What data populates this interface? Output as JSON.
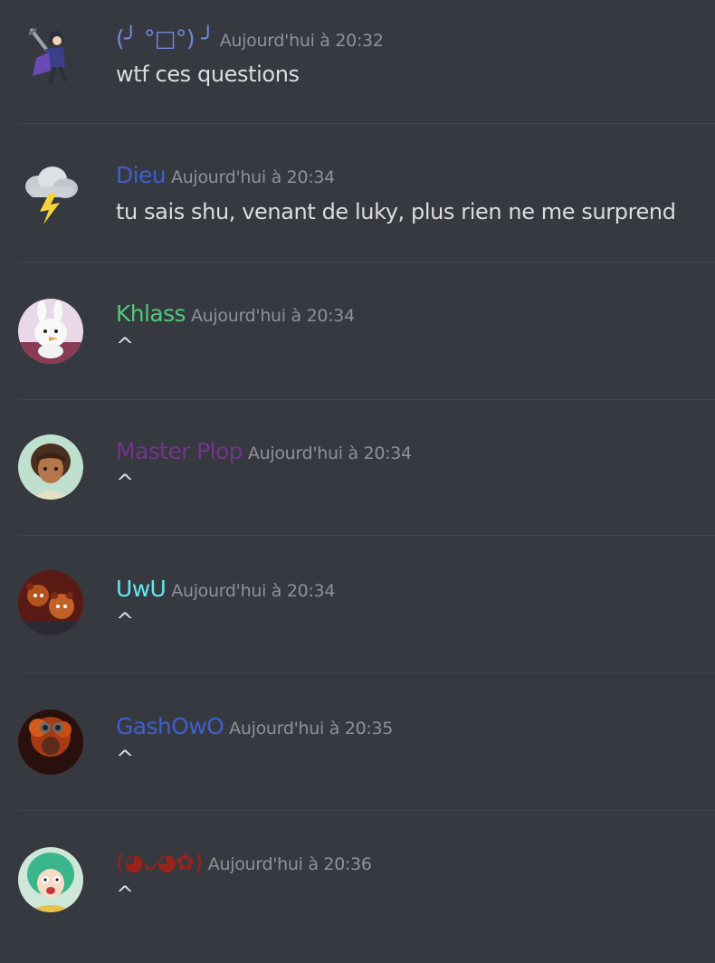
{
  "messages": [
    {
      "username": "(╯ °□°) ╯",
      "user_color": "#7289da",
      "timestamp": "Aujourd'hui à 20:32",
      "content": "wtf ces questions",
      "avatar_icon": "swordsman-avatar-icon"
    },
    {
      "username": "Dieu",
      "user_color": "#3e5fcf",
      "timestamp": "Aujourd'hui à 20:34",
      "content": "tu sais shu, venant de luky, plus rien ne me surprend",
      "avatar_icon": "storm-cloud-lightning-icon"
    },
    {
      "username": "Khlass",
      "user_color": "#4fc97a",
      "timestamp": "Aujourd'hui à 20:34",
      "content": "^",
      "avatar_icon": "rabbit-creature-avatar-icon"
    },
    {
      "username": "Master Plop",
      "user_color": "#71368a",
      "timestamp": "Aujourd'hui à 20:34",
      "content": "^",
      "avatar_icon": "anime-boy-avatar-icon"
    },
    {
      "username": "UwU",
      "user_color": "#62e7f2",
      "timestamp": "Aujourd'hui à 20:34",
      "content": "^",
      "avatar_icon": "cartoon-bears-avatar-icon"
    },
    {
      "username": "GashOwO",
      "user_color": "#3e5fcf",
      "timestamp": "Aujourd'hui à 20:35",
      "content": "^",
      "avatar_icon": "fire-hair-avatar-icon"
    },
    {
      "username": "(◕ᴗ◕✿)",
      "user_color": "#99221c",
      "timestamp": "Aujourd'hui à 20:36",
      "content": "^",
      "avatar_icon": "green-hair-girl-avatar-icon"
    }
  ]
}
